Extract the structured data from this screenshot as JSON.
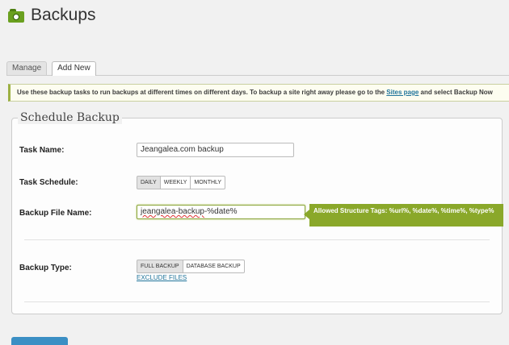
{
  "header": {
    "title": "Backups",
    "icon": "backup-folder-icon"
  },
  "tabs": [
    {
      "label": "Manage",
      "active": false
    },
    {
      "label": "Add New",
      "active": true
    }
  ],
  "notice": {
    "text_before": "Use these backup tasks to run backups at different times on different days. To backup a site right away please go to the ",
    "link": "Sites page",
    "text_after": " and select Backup Now"
  },
  "form": {
    "legend": "Schedule Backup",
    "task_name": {
      "label": "Task Name:",
      "value": "Jeangalea.com backup"
    },
    "task_schedule": {
      "label": "Task Schedule:",
      "options": [
        "DAILY",
        "WEEKLY",
        "MONTHLY"
      ],
      "selected": "DAILY"
    },
    "backup_file_name": {
      "label": "Backup File Name:",
      "value_misspelled": "jeangalea-backup",
      "value_rest": "-%date%",
      "tooltip": "Allowed Structure Tags: %url%, %date%, %time%, %type%"
    },
    "backup_type": {
      "label": "Backup Type:",
      "options": [
        "FULL BACKUP",
        "DATABASE BACKUP"
      ],
      "selected": "FULL BACKUP",
      "exclude_link": "EXCLUDE FILES"
    }
  },
  "colors": {
    "accent_green": "#8aa82a",
    "link_blue": "#21759b"
  }
}
